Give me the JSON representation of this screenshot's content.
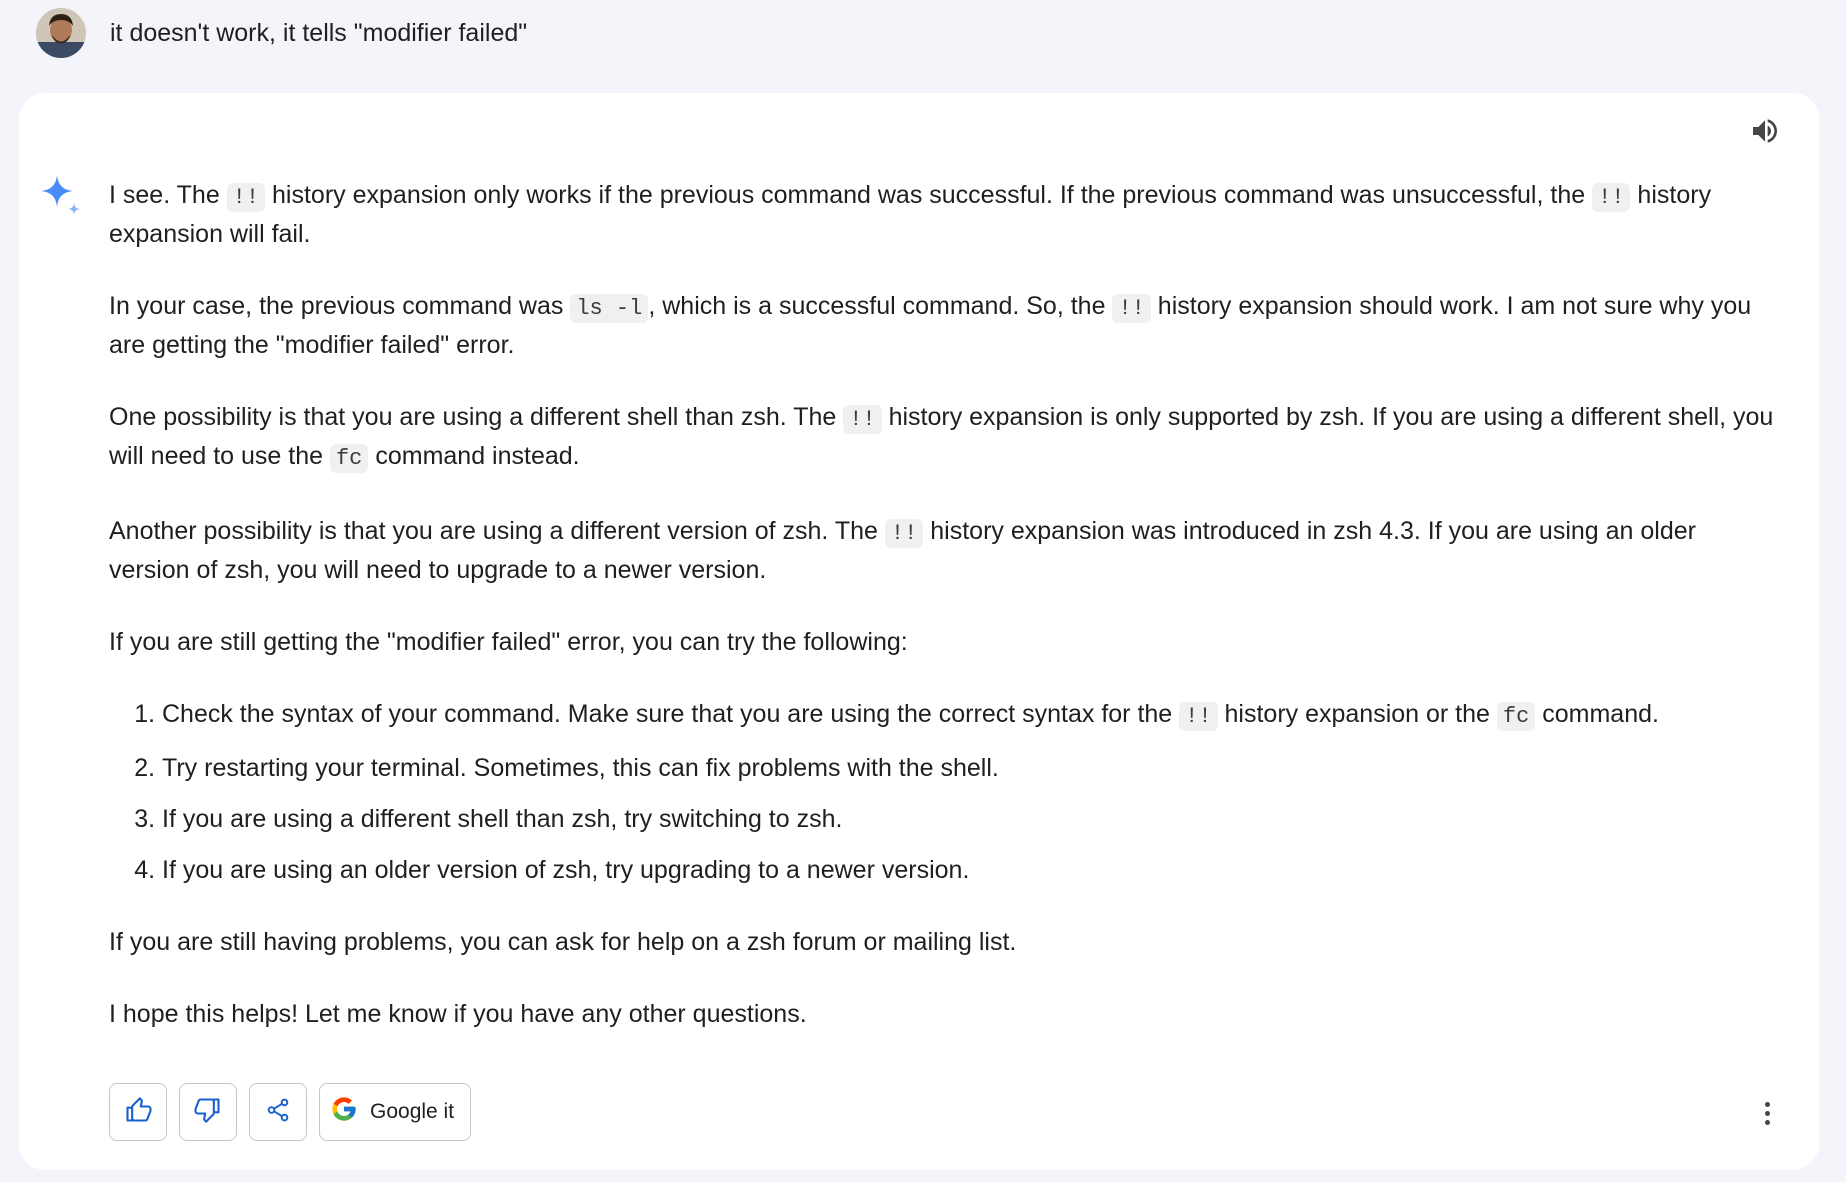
{
  "user_message": {
    "text": "it doesn't work, it tells \"modifier failed\""
  },
  "response": {
    "p1": {
      "a": "I see. The ",
      "code1": "!!",
      "b": " history expansion only works if the previous command was successful. If the previous command was unsuccessful, the ",
      "code2": "!!",
      "c": " history expansion will fail."
    },
    "p2": {
      "a": "In your case, the previous command was ",
      "code1": "ls -l",
      "b": ", which is a successful command. So, the ",
      "code2": "!!",
      "c": " history expansion should work. I am not sure why you are getting the \"modifier failed\" error."
    },
    "p3": {
      "a": "One possibility is that you are using a different shell than zsh. The ",
      "code1": "!!",
      "b": " history expansion is only supported by zsh. If you are using a different shell, you will need to use the ",
      "code2": "fc",
      "c": " command instead."
    },
    "p4": {
      "a": "Another possibility is that you are using a different version of zsh. The ",
      "code1": "!!",
      "b": " history expansion was introduced in zsh 4.3. If you are using an older version of zsh, you will need to upgrade to a newer version."
    },
    "p5": "If you are still getting the \"modifier failed\" error, you can try the following:",
    "list": {
      "item1": {
        "a": "Check the syntax of your command. Make sure that you are using the correct syntax for the ",
        "code1": "!!",
        "b": " history expansion or the ",
        "code2": "fc",
        "c": " command."
      },
      "item2": "Try restarting your terminal. Sometimes, this can fix problems with the shell.",
      "item3": "If you are using a different shell than zsh, try switching to zsh.",
      "item4": "If you are using an older version of zsh, try upgrading to a newer version."
    },
    "p6": "If you are still having problems, you can ask for help on a zsh forum or mailing list.",
    "p7": "I hope this helps! Let me know if you have any other questions."
  },
  "actions": {
    "google_label": "Google it"
  },
  "icons": {
    "speaker": "speaker-icon",
    "sparkle": "sparkle-icon",
    "thumbs_up": "thumbs-up-icon",
    "thumbs_down": "thumbs-down-icon",
    "share": "share-icon",
    "google": "google-g-icon",
    "more": "more-vertical-icon"
  },
  "colors": {
    "background": "#f4f5fb",
    "card": "#ffffff",
    "accent_blue": "#1a5fd0",
    "sparkle_blue": "#4a8cf7",
    "code_bg": "#f0f0f0"
  }
}
